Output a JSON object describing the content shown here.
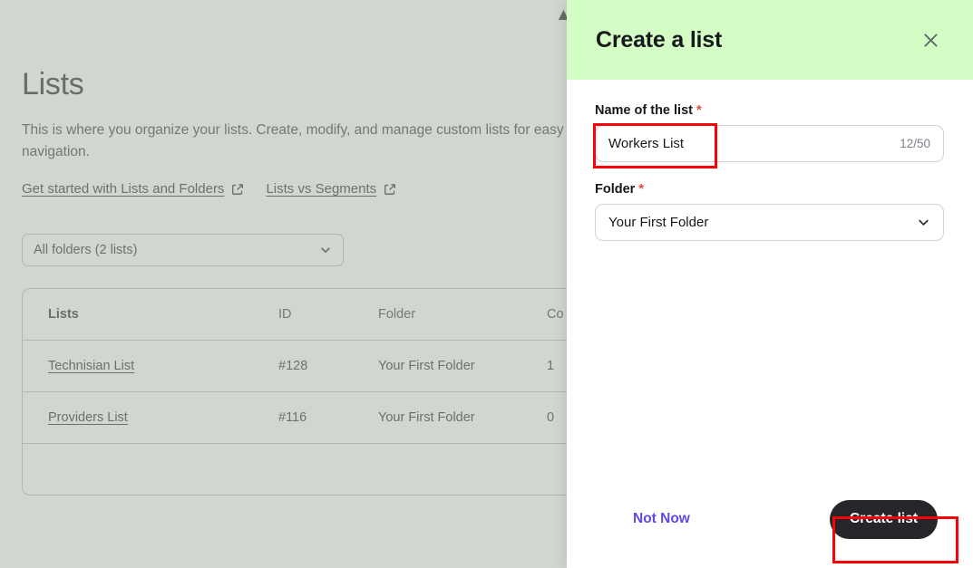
{
  "page": {
    "top_icon": "logo-glyph",
    "title": "Lists",
    "description": "This is where you organize your lists. Create, modify, and manage custom lists for easy navigation.",
    "help_links": [
      {
        "label": "Get started with Lists and Folders",
        "icon": "external-link-icon"
      },
      {
        "label": "Lists vs Segments",
        "icon": "external-link-icon"
      }
    ],
    "folder_filter": {
      "value": "All folders (2 lists)",
      "icon": "chevron-down-icon"
    },
    "table": {
      "columns": [
        "Lists",
        "ID",
        "Folder",
        "Co"
      ],
      "rows": [
        {
          "name": "Technisian List",
          "id": "#128",
          "folder": "Your First Folder",
          "contacts": "1"
        },
        {
          "name": "Providers List",
          "id": "#116",
          "folder": "Your First Folder",
          "contacts": "0"
        }
      ]
    }
  },
  "modal": {
    "title": "Create a list",
    "close_icon": "close-icon",
    "header_color": "#d4fdc5",
    "fields": {
      "name": {
        "label": "Name of the list",
        "required_mark": "*",
        "value": "Workers List",
        "placeholder": "Name of the list",
        "counter": "12/50"
      },
      "folder": {
        "label": "Folder",
        "required_mark": "*",
        "value": "Your First Folder",
        "icon": "chevron-down-icon"
      }
    },
    "footer": {
      "secondary_label": "Not Now",
      "primary_label": "Create list",
      "primary_color": "#26262a",
      "secondary_color": "#6049e0"
    }
  },
  "annotations": {
    "highlight_color": "#fb0007",
    "boxes": [
      {
        "name": "name-input-highlight"
      },
      {
        "name": "create-list-button-highlight"
      }
    ]
  }
}
